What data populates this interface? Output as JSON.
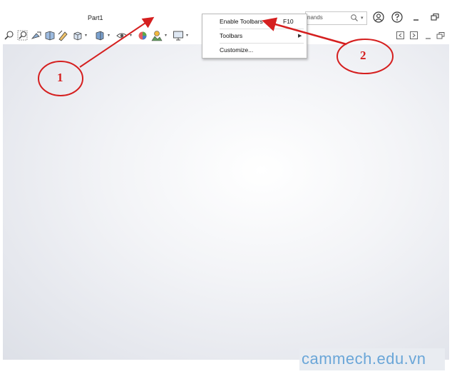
{
  "window": {
    "title": "Part1"
  },
  "search": {
    "text": "nands"
  },
  "context_menu": {
    "items": [
      {
        "label": "Enable Toolbars",
        "shortcut": "F10"
      },
      {
        "label": "Toolbars",
        "submenu": true
      },
      {
        "label": "Customize..."
      }
    ]
  },
  "annotations": {
    "callout_1": "1",
    "callout_2": "2",
    "color": "#d51f1f"
  },
  "watermark": {
    "text": "cammech.edu.vn"
  },
  "colors": {
    "viewport_center": "#ffffff",
    "viewport_edge": "#dde0e7",
    "annotation": "#d51f1f",
    "watermark": "#6aa6d8"
  }
}
